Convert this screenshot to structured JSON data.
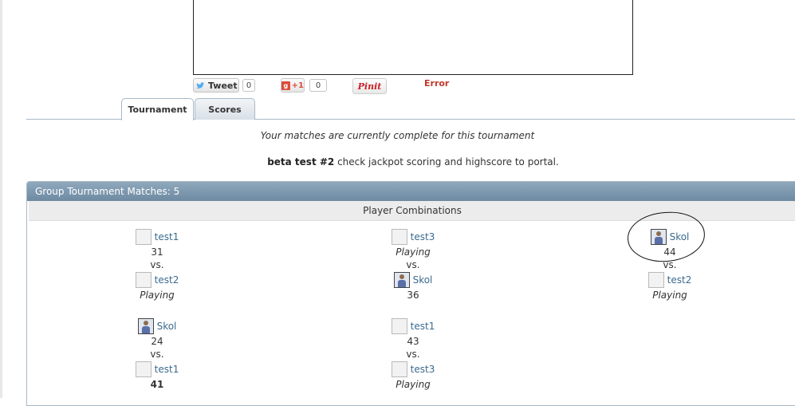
{
  "social": {
    "tweet_label": "Tweet",
    "tweet_count": "0",
    "gplus_label": "+1",
    "gplus_count": "0",
    "pin_label": "Pinit",
    "error_text": "Error"
  },
  "tabs": [
    {
      "label": "Tournament",
      "active": true
    },
    {
      "label": "Scores",
      "active": false
    }
  ],
  "status_message": "Your matches are currently complete for this tournament",
  "description": {
    "title": "beta test #2",
    "text": " check jackpot scoring and highscore to portal."
  },
  "panel": {
    "header": "Group Tournament Matches: 5",
    "subheader": "Player Combinations"
  },
  "vs_label": "vs.",
  "matches": [
    {
      "p1": {
        "name": "test1",
        "avatar": "default",
        "score": "31"
      },
      "p2": {
        "name": "test2",
        "avatar": "default",
        "score": "Playing"
      }
    },
    {
      "p1": {
        "name": "test3",
        "avatar": "default",
        "score": "Playing"
      },
      "p2": {
        "name": "Skol",
        "avatar": "photo",
        "score": "36"
      }
    },
    {
      "p1": {
        "name": "Skol",
        "avatar": "photo",
        "score": "44"
      },
      "p2": {
        "name": "test2",
        "avatar": "default",
        "score": "Playing"
      }
    },
    {
      "p1": {
        "name": "Skol",
        "avatar": "photo",
        "score": "24"
      },
      "p2": {
        "name": "test1",
        "avatar": "default",
        "score": "41",
        "winner": true
      }
    },
    {
      "p1": {
        "name": "test1",
        "avatar": "default",
        "score": "43"
      },
      "p2": {
        "name": "test3",
        "avatar": "default",
        "score": "Playing"
      }
    }
  ],
  "colors": {
    "panel_header": "#7a94ab",
    "link": "#3a6a8e",
    "error": "#c0392b"
  }
}
